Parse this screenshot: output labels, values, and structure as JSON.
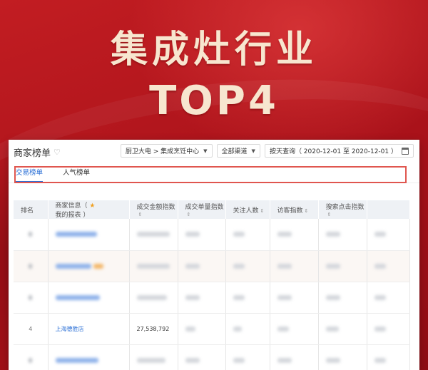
{
  "headline": {
    "line1": "集成灶行业",
    "line2": "TOP4"
  },
  "card": {
    "title": "商家榜单",
    "category_filter": "厨卫大电 > 集成烹饪中心",
    "channel_filter": "全部渠道",
    "date_filter": "按天查询（ 2020-12-01 至 2020-12-01 ）"
  },
  "tabs": [
    {
      "label": "交易榜单",
      "active": true
    },
    {
      "label": "人气榜单",
      "active": false
    }
  ],
  "table": {
    "columns": [
      "排名",
      "商家信息（ ",
      "我的报表 ）",
      "成交金额指数",
      "成交单量指数",
      "关注人数",
      "访客指数",
      "搜索点击指数"
    ],
    "highlight_row": {
      "rank": "4",
      "shop": "上海德胜店",
      "amount": "27,538,792"
    }
  },
  "colors": {
    "accent": "#2a6fd6",
    "highlight_border": "#e0564f",
    "background_red": "#b8161c",
    "headline_cream": "#f7e6cf"
  }
}
